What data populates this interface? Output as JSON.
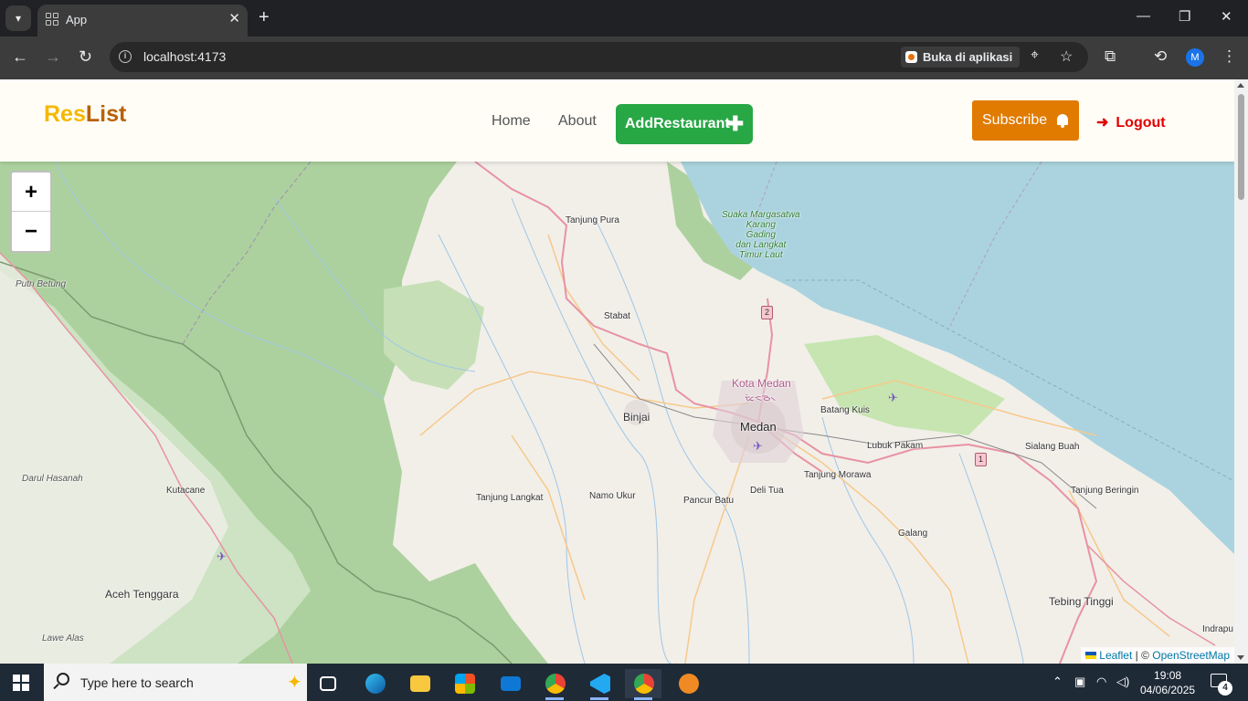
{
  "browser": {
    "tab_title": "App",
    "url": "localhost:4173",
    "open_in_app_label": "Buka di aplikasi",
    "profile_initial": "M"
  },
  "navbar": {
    "brand_part1": "Res",
    "brand_part2": "List",
    "links": [
      "Home",
      "About"
    ],
    "add_button_label": "AddRestaurant",
    "subscribe_label": "Subscribe",
    "logout_label": "Logout",
    "colors": {
      "brand_yellow": "#f5b800",
      "brand_brown": "#b8620a",
      "add_green": "#28a745",
      "subscribe_orange": "#e07b00",
      "logout_red": "#e00000"
    }
  },
  "map": {
    "zoom_in": "+",
    "zoom_out": "−",
    "attribution_leaflet": "Leaflet",
    "attribution_separator": " | © ",
    "attribution_osm": "OpenStreetMap",
    "labels": {
      "tanjung_pura": "Tanjung Pura",
      "suaka_1": "Suaka Margasatwa",
      "suaka_2": "Karang",
      "suaka_3": "Gading",
      "suaka_4": "dan Langkat",
      "suaka_5": "Timur Laut",
      "putri_betung": "Putri Betung",
      "stabat": "Stabat",
      "kota_medan": "Kota Medan",
      "kota_medan_script": "ᯔᯩᯑᯉ᯲",
      "batang_kuis": "Batang Kuis",
      "binjai": "Binjai",
      "medan": "Medan",
      "lubuk_pakam": "Lubuk Pakam",
      "sialang_buah": "Sialang Buah",
      "darul_hasanah": "Darul Hasanah",
      "kutacane": "Kutacane",
      "tanjung_morawa": "Tanjung Morawa",
      "tanjung_langkat": "Tanjung Langkat",
      "namo_ukur": "Namo Ukur",
      "pancur_batu": "Pancur Batu",
      "deli_tua": "Deli Tua",
      "tanjung_beringin": "Tanjung Beringin",
      "galang": "Galang",
      "aceh_tenggara": "Aceh Tenggara",
      "tebing_tinggi": "Tebing Tinggi",
      "lawe_alas": "Lawe Alas",
      "indrapura": "Indrapu"
    },
    "road_shields": [
      "2",
      "1"
    ],
    "colors": {
      "land": "#f2efe9",
      "sea": "#aad3df",
      "forest": "#add19e",
      "primary_road": "#e892a2",
      "secondary_road": "#f7c98b"
    }
  },
  "taskbar": {
    "search_placeholder": "Type here to search",
    "time": "19:08",
    "date": "04/06/2025",
    "notification_count": "4",
    "apps": [
      "task-view",
      "edge",
      "file-explorer",
      "microsoft-store",
      "mail",
      "chrome-y",
      "vscode",
      "chrome-m",
      "app-orange"
    ]
  }
}
